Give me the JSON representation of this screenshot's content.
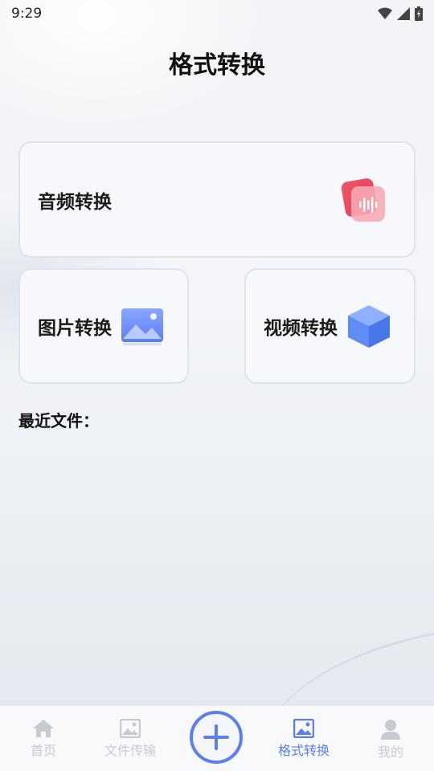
{
  "status_bar": {
    "time": "9:29"
  },
  "header": {
    "title": "格式转换"
  },
  "cards": {
    "audio": {
      "label": "音频转换",
      "icon": "audio-wave-icon"
    },
    "image": {
      "label": "图片转换",
      "icon": "image-icon"
    },
    "video": {
      "label": "视频转换",
      "icon": "cube-icon"
    }
  },
  "recent": {
    "title": "最近文件："
  },
  "bottom_nav": {
    "items": [
      {
        "label": "首页",
        "icon": "home-icon",
        "active": false
      },
      {
        "label": "文件传输",
        "icon": "image-icon",
        "active": false
      },
      {
        "label": "add",
        "icon": "plus-icon",
        "active": false
      },
      {
        "label": "格式转换",
        "icon": "image-icon",
        "active": true
      },
      {
        "label": "我的",
        "icon": "user-icon",
        "active": false
      }
    ]
  },
  "colors": {
    "accent": "#5b7ff0",
    "inactive": "#c7cbd1",
    "audio_icon": "#ec4a5f",
    "card_border": "#dde3f3"
  }
}
